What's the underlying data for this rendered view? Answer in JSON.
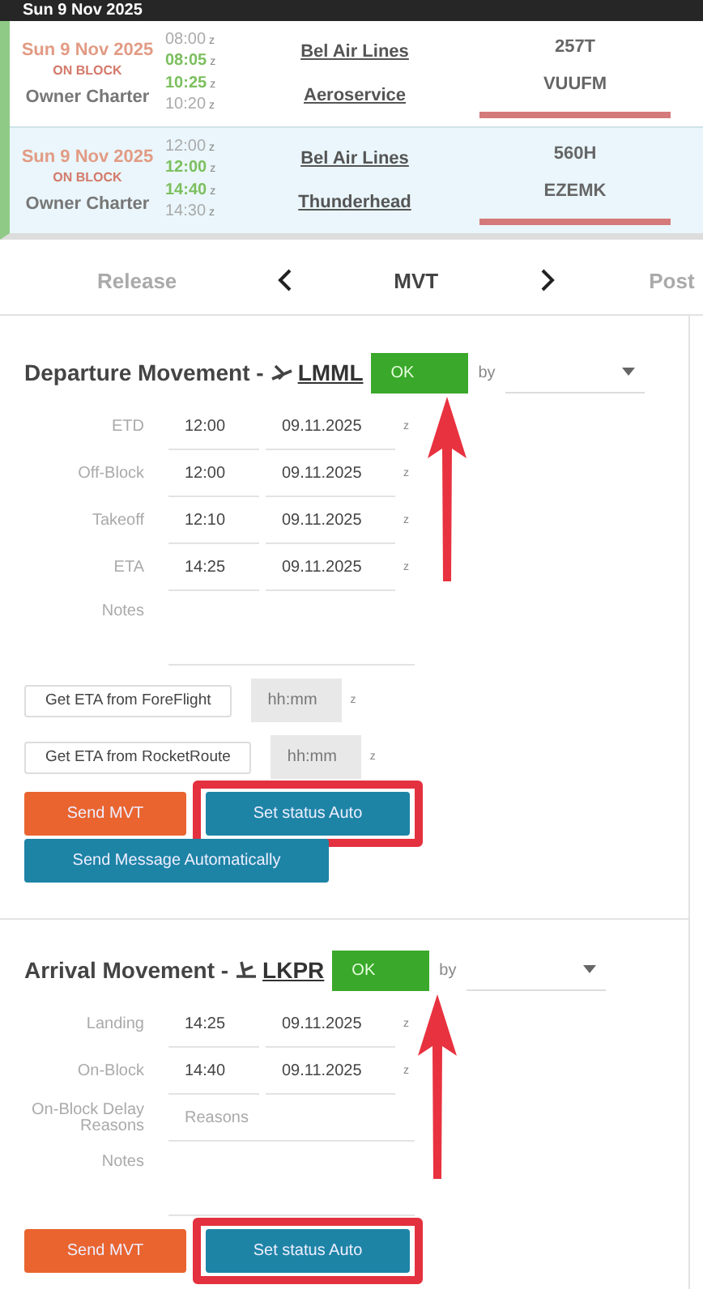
{
  "date_header": "Sun 9 Nov 2025",
  "flights": [
    {
      "date": "Sun 9 Nov 2025",
      "status": "ON BLOCK",
      "type": "Owner Charter",
      "times": [
        {
          "value": "08:00",
          "unit": "z",
          "actual": false
        },
        {
          "value": "08:05",
          "unit": "z",
          "actual": true
        },
        {
          "value": "10:25",
          "unit": "z",
          "actual": true
        },
        {
          "value": "10:20",
          "unit": "z",
          "actual": false
        }
      ],
      "operators": [
        "Bel Air Lines",
        "Aeroservice"
      ],
      "codes": [
        "257T",
        "VUUFM"
      ],
      "selected": false
    },
    {
      "date": "Sun 9 Nov 2025",
      "status": "ON BLOCK",
      "type": "Owner Charter",
      "times": [
        {
          "value": "12:00",
          "unit": "z",
          "actual": false
        },
        {
          "value": "12:00",
          "unit": "z",
          "actual": true
        },
        {
          "value": "14:40",
          "unit": "z",
          "actual": true
        },
        {
          "value": "14:30",
          "unit": "z",
          "actual": false
        }
      ],
      "operators": [
        "Bel Air Lines",
        "Thunderhead"
      ],
      "codes": [
        "560H",
        "EZEMK"
      ],
      "selected": true
    }
  ],
  "tabs": [
    {
      "label": "Release",
      "selected": false
    },
    {
      "label": "MVT",
      "selected": true
    },
    {
      "label": "Post",
      "selected": false
    }
  ],
  "sections": [
    {
      "title": "Departure Movement -",
      "kind": "departure",
      "airport": "LMML",
      "status": "OK",
      "by_label": "by",
      "arrow_to_status": true,
      "fields": [
        {
          "kind": "time",
          "label": "ETD",
          "time": "12:00",
          "date": "09.11.2025",
          "unit": "z"
        },
        {
          "kind": "time",
          "label": "Off-Block",
          "time": "12:00",
          "date": "09.11.2025",
          "unit": "z"
        },
        {
          "kind": "time",
          "label": "Takeoff",
          "time": "12:10",
          "date": "09.11.2025",
          "unit": "z"
        },
        {
          "kind": "time",
          "label": "ETA",
          "time": "14:25",
          "date": "09.11.2025",
          "unit": "z"
        },
        {
          "kind": "notes",
          "label": "Notes"
        }
      ],
      "eta_sources": [
        {
          "label": "Get ETA from ForeFlight",
          "placeholder": "hh:mm",
          "unit": "z"
        },
        {
          "label": "Get ETA from RocketRoute",
          "placeholder": "hh:mm",
          "unit": "z"
        }
      ],
      "buttons": [
        {
          "label": "Send MVT",
          "kind": "send",
          "highlighted": false
        },
        {
          "label": "Set status Auto",
          "kind": "auto",
          "highlighted": true
        },
        {
          "label": "Send Message Automatically",
          "kind": "auto",
          "highlighted": false
        }
      ]
    },
    {
      "title": "Arrival Movement -",
      "kind": "arrival",
      "airport": "LKPR",
      "status": "OK",
      "by_label": "by",
      "arrow_to_status": true,
      "fields": [
        {
          "kind": "time",
          "label": "Landing",
          "time": "14:25",
          "date": "09.11.2025",
          "unit": "z"
        },
        {
          "kind": "time",
          "label": "On-Block",
          "time": "14:40",
          "date": "09.11.2025",
          "unit": "z"
        },
        {
          "kind": "text",
          "label": "On-Block Delay Reasons",
          "placeholder": "Reasons"
        },
        {
          "kind": "notes",
          "label": "Notes"
        }
      ],
      "buttons": [
        {
          "label": "Send MVT",
          "kind": "send",
          "highlighted": false
        },
        {
          "label": "Set status Auto",
          "kind": "auto",
          "highlighted": true
        }
      ]
    }
  ]
}
